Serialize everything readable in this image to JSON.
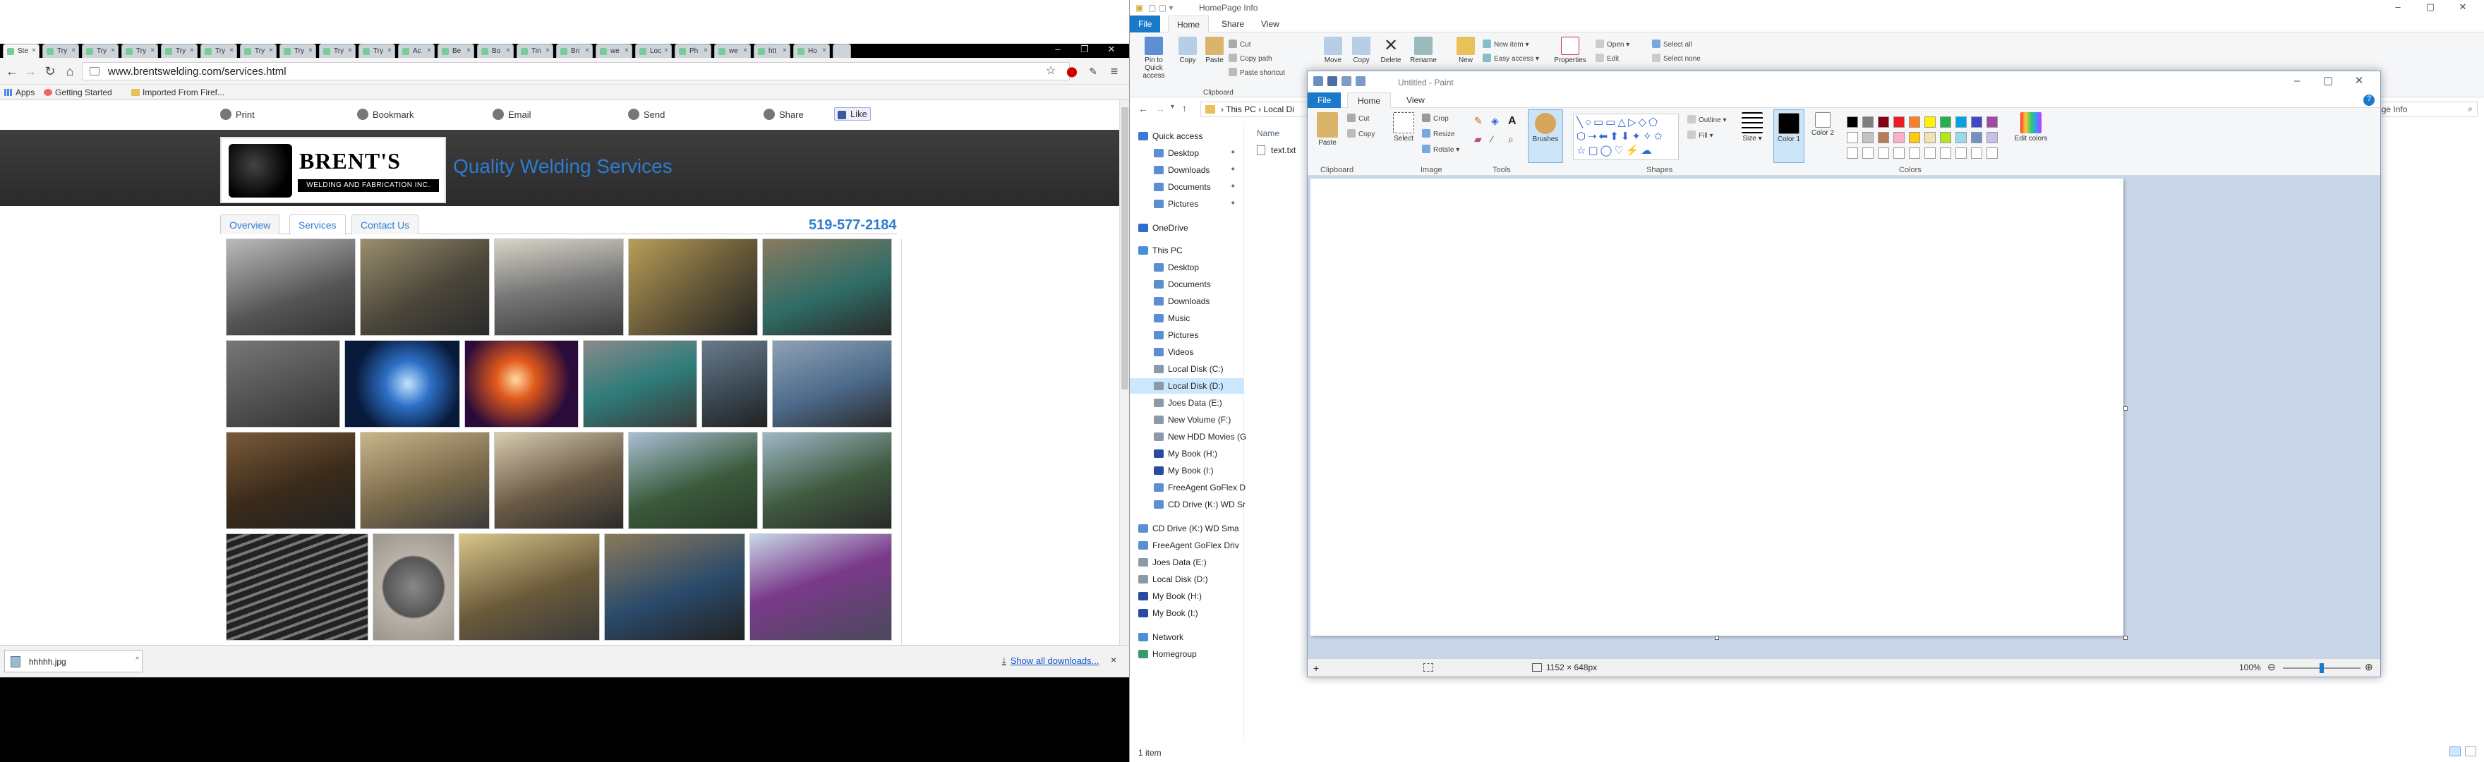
{
  "browser": {
    "tabs": [
      {
        "label": "Ste",
        "active": true
      },
      {
        "label": "Try"
      },
      {
        "label": "Try"
      },
      {
        "label": "Try"
      },
      {
        "label": "Try"
      },
      {
        "label": "Try"
      },
      {
        "label": "Try"
      },
      {
        "label": "Try"
      },
      {
        "label": "Try"
      },
      {
        "label": "Try"
      },
      {
        "label": "Ac"
      },
      {
        "label": "Be"
      },
      {
        "label": "Bo"
      },
      {
        "label": "Tin"
      },
      {
        "label": "Bri"
      },
      {
        "label": "we"
      },
      {
        "label": "Loc"
      },
      {
        "label": "Ph"
      },
      {
        "label": "we"
      },
      {
        "label": "htt"
      },
      {
        "label": "Ho"
      }
    ],
    "url": "www.brentswelding.com/services.html",
    "bookmarks": {
      "apps": "Apps",
      "getting_started": "Getting Started",
      "imported": "Imported From Firef..."
    },
    "site": {
      "share_bar": {
        "print": "Print",
        "bookmark": "Bookmark",
        "email": "Email",
        "send": "Send",
        "share": "Share",
        "like": "Like"
      },
      "logo_name": "BRENT'S",
      "logo_sub": "WELDING AND FABRICATION INC.",
      "tagline": "Quality Welding Services",
      "phone": "519-577-2184",
      "nav_tabs": [
        "Overview",
        "Services",
        "Contact Us"
      ],
      "active_tab": "Services"
    },
    "downloads": {
      "file": "hhhhh.jpg",
      "show_all": "Show all downloads...",
      "close": "×"
    }
  },
  "explorer": {
    "title": "HomePage Info",
    "menu": [
      "File",
      "Home",
      "Share",
      "View"
    ],
    "ribbon": {
      "pin": "Pin to Quick access",
      "copy": "Copy",
      "paste": "Paste",
      "cut": "Cut",
      "copy_path": "Copy path",
      "paste_shortcut": "Paste shortcut",
      "clipboard": "Clipboard",
      "move_to": "Move",
      "copy_to": "Copy",
      "delete": "Delete",
      "rename": "Rename",
      "new": "New",
      "new_item": "New item",
      "easy_access": "Easy access",
      "properties": "Properties",
      "open": "Open",
      "edit": "Edit",
      "select_all": "Select all",
      "select_none": "Select none"
    },
    "address": {
      "this_pc": "This PC",
      "local": "Local Di"
    },
    "search_placeholder": "HomePage Info",
    "nav": [
      {
        "label": "Quick access",
        "indent": 0
      },
      {
        "label": "Desktop",
        "indent": 1,
        "pin": true
      },
      {
        "label": "Downloads",
        "indent": 1,
        "pin": true
      },
      {
        "label": "Documents",
        "indent": 1,
        "pin": true
      },
      {
        "label": "Pictures",
        "indent": 1,
        "pin": true
      },
      {
        "label": "OneDrive",
        "indent": 0
      },
      {
        "label": "This PC",
        "indent": 0
      },
      {
        "label": "Desktop",
        "indent": 1
      },
      {
        "label": "Documents",
        "indent": 1
      },
      {
        "label": "Downloads",
        "indent": 1
      },
      {
        "label": "Music",
        "indent": 1
      },
      {
        "label": "Pictures",
        "indent": 1
      },
      {
        "label": "Videos",
        "indent": 1
      },
      {
        "label": "Local Disk (C:)",
        "indent": 1
      },
      {
        "label": "Local Disk (D:)",
        "indent": 1,
        "selected": true
      },
      {
        "label": "Joes Data (E:)",
        "indent": 1
      },
      {
        "label": "New Volume (F:)",
        "indent": 1
      },
      {
        "label": "New HDD Movies (G",
        "indent": 1
      },
      {
        "label": "My Book (H:)",
        "indent": 1
      },
      {
        "label": "My Book (I:)",
        "indent": 1
      },
      {
        "label": "FreeAgent GoFlex D",
        "indent": 1
      },
      {
        "label": "CD Drive (K:) WD Sr",
        "indent": 1
      },
      {
        "label": "CD Drive (K:) WD Sma",
        "indent": 0
      },
      {
        "label": "FreeAgent GoFlex Driv",
        "indent": 0
      },
      {
        "label": "Joes Data (E:)",
        "indent": 0
      },
      {
        "label": "Local Disk (D:)",
        "indent": 0
      },
      {
        "label": "My Book (H:)",
        "indent": 0
      },
      {
        "label": "My Book (I:)",
        "indent": 0
      },
      {
        "label": "Network",
        "indent": 0
      },
      {
        "label": "Homegroup",
        "indent": 0
      }
    ],
    "column_name": "Name",
    "files": [
      "text.txt"
    ],
    "status": "1 item"
  },
  "paint": {
    "title": "Untitled - Paint",
    "menu": [
      "File",
      "Home",
      "View"
    ],
    "ribbon": {
      "paste": "Paste",
      "cut": "Cut",
      "copy": "Copy",
      "select": "Select",
      "crop": "Crop",
      "resize": "Resize",
      "rotate": "Rotate",
      "brushes": "Brushes",
      "outline": "Outline",
      "fill": "Fill",
      "size": "Size",
      "color1": "Color 1",
      "color2": "Color 2",
      "edit_colors": "Edit colors"
    },
    "groups": [
      "Clipboard",
      "Image",
      "Tools",
      "Shapes",
      "Colors"
    ],
    "palette": [
      "#000000",
      "#7f7f7f",
      "#880015",
      "#ed1c24",
      "#ff7f27",
      "#fff200",
      "#22b14c",
      "#00a2e8",
      "#3f48cc",
      "#a349a4",
      "#ffffff",
      "#c3c3c3",
      "#b97a57",
      "#ffaec9",
      "#ffc90e",
      "#efe4b0",
      "#b5e61d",
      "#99d9ea",
      "#7092be",
      "#c8bfe7"
    ],
    "canvas_size": "1152 × 648px",
    "zoom": "100%"
  }
}
